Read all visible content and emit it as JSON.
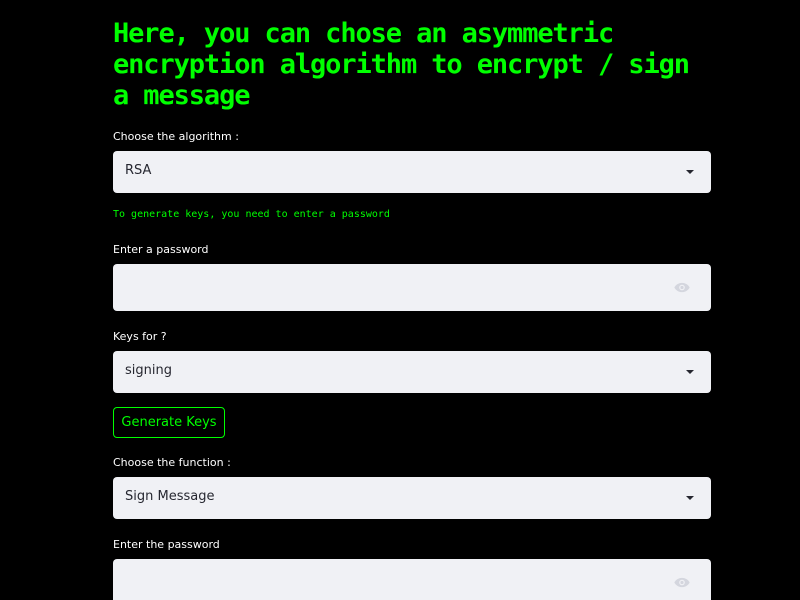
{
  "colors": {
    "background": "#000000",
    "accent": "#00ff00",
    "field_background": "#f0f1f5"
  },
  "page": {
    "title": "Here, you can chose an asymmetric encryption algorithm to encrypt / sign a message"
  },
  "algorithm": {
    "label": "Choose the algorithm :",
    "selected": "RSA",
    "icon": "chevron-down-icon"
  },
  "info_text": "To generate keys, you need to enter a password",
  "password": {
    "label": "Enter a password",
    "value": "",
    "icon": "eye-icon"
  },
  "keys_for": {
    "label": "Keys for ?",
    "selected": "signing",
    "icon": "chevron-down-icon"
  },
  "generate_button": {
    "label": "Generate Keys"
  },
  "function": {
    "label": "Choose the function :",
    "selected": "Sign Message",
    "icon": "chevron-down-icon"
  },
  "function_password": {
    "label": "Enter the password",
    "value": "",
    "icon": "eye-icon"
  }
}
